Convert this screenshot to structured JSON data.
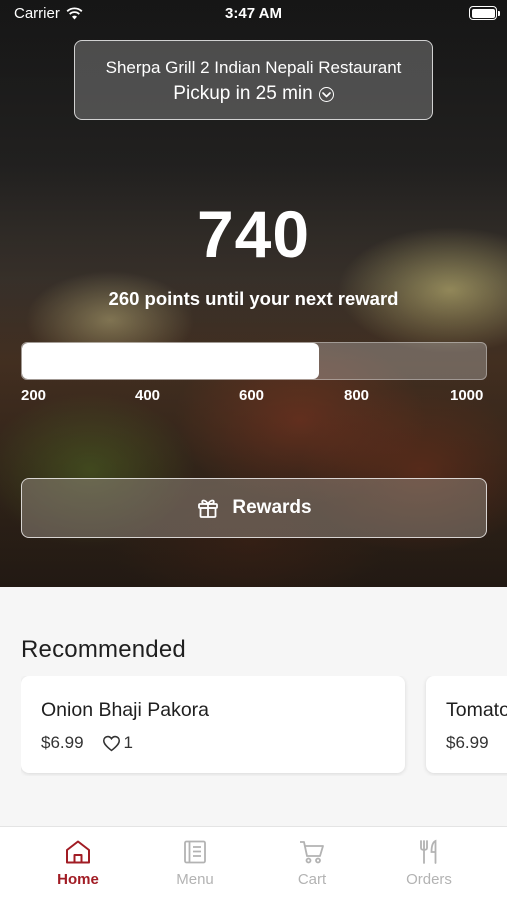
{
  "status_bar": {
    "carrier": "Carrier",
    "time": "3:47 AM"
  },
  "store": {
    "name": "Sherpa Grill 2 Indian Nepali Restaurant",
    "pickup": "Pickup in 25 min",
    "chevron_icon": "chevron-down-circle-icon"
  },
  "rewards": {
    "points": "740",
    "caption": "260 points until your next reward",
    "progress_fraction": 0.64,
    "ticks": [
      "200",
      "400",
      "600",
      "800",
      "1000"
    ],
    "button_label": "Rewards",
    "button_icon": "gift-icon"
  },
  "recommended": {
    "title": "Recommended",
    "items": [
      {
        "name": "Onion Bhaji Pakora",
        "price": "$6.99",
        "likes": "1"
      },
      {
        "name": "Tomato",
        "price": "$6.99"
      }
    ]
  },
  "tabs": [
    {
      "label": "Home",
      "icon": "home-icon",
      "active": true
    },
    {
      "label": "Menu",
      "icon": "menu-book-icon",
      "active": false
    },
    {
      "label": "Cart",
      "icon": "cart-icon",
      "active": false
    },
    {
      "label": "Orders",
      "icon": "fork-knife-icon",
      "active": false
    }
  ],
  "colors": {
    "accent": "#a11c24",
    "tab_inactive": "#b3b3b3",
    "background": "#f6f6f6"
  }
}
